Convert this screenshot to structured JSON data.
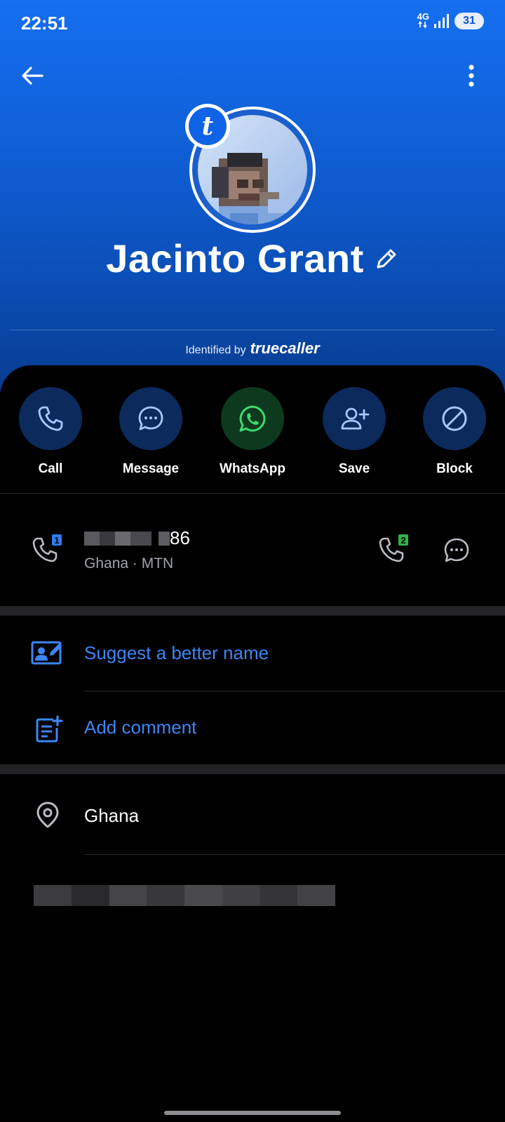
{
  "status_bar": {
    "time": "22:51",
    "network": "4G",
    "battery": "31"
  },
  "header": {
    "back_icon": "arrow-left-icon",
    "more_icon": "more-vert-icon",
    "badge_letter": "t",
    "contact_name": "Jacinto Grant",
    "edit_icon": "pencil-icon",
    "identified_by": "Identified by",
    "brand": "truecaller"
  },
  "actions": [
    {
      "label": "Call",
      "icon": "phone-icon"
    },
    {
      "label": "Message",
      "icon": "chat-bubble-icon"
    },
    {
      "label": "WhatsApp",
      "icon": "whatsapp-icon"
    },
    {
      "label": "Save",
      "icon": "add-person-icon"
    },
    {
      "label": "Block",
      "icon": "block-icon"
    }
  ],
  "phone": {
    "number_visible": "86",
    "sub": "Ghana · MTN",
    "sim1_label": "1",
    "sim2_label": "2"
  },
  "menu": {
    "suggest": "Suggest a better name",
    "comment": "Add comment"
  },
  "location": {
    "country": "Ghana"
  },
  "colors": {
    "accent": "#3d86f5",
    "header_top": "#156ff0",
    "whatsapp_green": "#25d366",
    "sim2_green": "#2fb34a"
  }
}
